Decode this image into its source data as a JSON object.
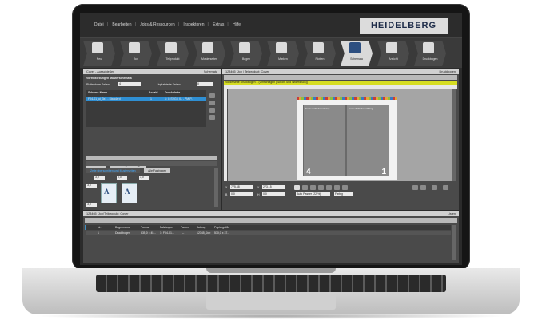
{
  "menu": {
    "items": [
      "Datei",
      "Bearbeiten",
      "Jobs & Ressourcen",
      "Inspektoren",
      "Extras",
      "Hilfe"
    ],
    "logo": "HEIDELBERG"
  },
  "toolbar": {
    "steps": [
      {
        "label": "Neu",
        "icon": "new-job-icon"
      },
      {
        "label": "Job",
        "icon": "job-icon"
      },
      {
        "label": "Teilprodukt",
        "icon": "part-product-icon"
      },
      {
        "label": "Musterseiten",
        "icon": "master-pages-icon"
      },
      {
        "label": "Bogen",
        "icon": "sheet-icon"
      },
      {
        "label": "Marken",
        "icon": "marks-icon"
      },
      {
        "label": "Plotten",
        "icon": "plot-icon"
      },
      {
        "label": "Schemata",
        "icon": "schemes-icon"
      },
      {
        "label": "Ansicht",
        "icon": "view-icon"
      },
      {
        "label": "Druckbogen",
        "icon": "press-sheet-icon"
      }
    ],
    "active_index": 7
  },
  "left_panel": {
    "title": "Cover - Ausschießen",
    "title_right": "Schemata",
    "section_label": "Voreinstellungen Musterschemata",
    "planned_pages_label": "Plattenbare Seiten",
    "planned_pages_value": "4",
    "unplaced_label": "Unplatzierte Seiten",
    "unplaced_value": "0",
    "table_headers": [
      "Schema-Name",
      "Anzahl",
      "Druckplatte"
    ],
    "table_rows": [
      {
        "name": "F04-01_ui_3x1 - Standard",
        "count": "1",
        "plate": "1: C:SVG3 XL - PM-P..."
      }
    ],
    "lower_tabs": [
      "Varianten",
      "Einteilung Druckbogen"
    ],
    "lower_subtabs": [
      "Zeile überschritten und Musterseiten",
      "Alle Falzbogen"
    ],
    "gap_values": [
      "3,0",
      "0,0",
      "3,0",
      "3,0",
      "3,0"
    ]
  },
  "main_panel": {
    "title": "123465_Job / Teilprodukt: Cover",
    "title_right": "Druckbogen",
    "tabs": [
      "Druckbogen",
      "Falzbogen",
      "Seitenliste",
      "Druckbogenliste",
      "Dokument"
    ],
    "active_tab": 0,
    "info_bar": "Vorderseite   Druckbogen 1 (Umschlagen (Schön- und Widerdruck))",
    "page_labels": [
      "Kosto Schiebemaßring",
      "Kosto Schiebemaßring"
    ],
    "page_numbers": [
      "4",
      "1"
    ],
    "coord_x_label": "X",
    "coord_x_value": "775,48",
    "coord_y_label": "Y",
    "coord_y_value": "273,15",
    "coord_b_label": "B",
    "coord_b_value": "0,0",
    "coord_h_label": "H",
    "coord_h_value": "0,0",
    "zoom_value": "Auto Passer (22 %)",
    "color_select": "Farbig"
  },
  "bottom_panel": {
    "title": "123465_Job/Teilprodukt: Cover",
    "title_right": "Listen",
    "tabs": [
      "Druckbogen",
      "Falzbogen",
      "Seitenliste",
      "Zugewiesen",
      "Nicht zugewiesen"
    ],
    "active_tab": 0,
    "headers": [
      "Nr.",
      "Bogenname",
      "Format",
      "Falzbogen",
      "Farben",
      "Auftrag",
      "Papiergröße"
    ],
    "rows": [
      {
        "nr": "1",
        "name": "Druckbogen",
        "format": "535,0 x 45...",
        "fold": "1: F04-01...",
        "colors": "--",
        "order": "12345_Job",
        "paper": "530,0 x 37..."
      }
    ]
  }
}
